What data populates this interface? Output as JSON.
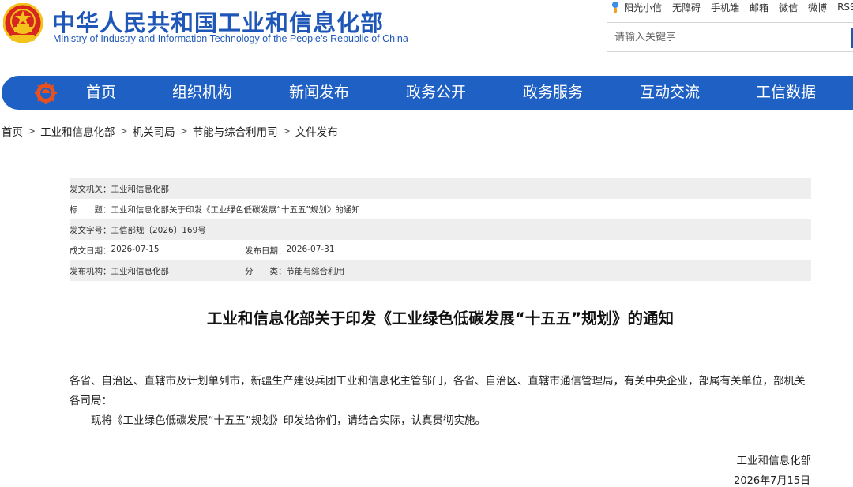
{
  "header": {
    "title": "中华人民共和国工业和信息化部",
    "subtitle": "Ministry of Industry and Information Technology of the People’s Republic of China",
    "top_links": [
      "阳光小信",
      "无障碍",
      "手机端",
      "邮箱",
      "微信",
      "微博",
      "RSS"
    ],
    "search_placeholder": "请输入关键字"
  },
  "nav": {
    "items": [
      "首页",
      "组织机构",
      "新闻发布",
      "政务公开",
      "政务服务",
      "互动交流",
      "工信数据"
    ]
  },
  "breadcrumb": [
    "首页",
    "工业和信息化部",
    "机关司局",
    "节能与综合利用司",
    "文件发布"
  ],
  "info": {
    "issuer_label": "发文机关：",
    "issuer": "工业和信息化部",
    "title_label": "标　　题：",
    "title": "工业和信息化部关于印发《工业绿色低碳发展“十五五”规划》的通知",
    "docno_label": "发文字号：",
    "docno": "工信部规〔2026〕169号",
    "written_label": "成文日期：",
    "written": "2026-07-15",
    "published_label": "发布日期：",
    "published": "2026-07-31",
    "agency_label": "发布机构：",
    "agency": "工业和信息化部",
    "category_label": "分　　类：",
    "category": "节能与综合利用"
  },
  "article": {
    "title": "工业和信息化部关于印发《工业绿色低碳发展“十五五”规划》的通知",
    "para1": "各省、自治区、直辖市及计划单列市，新疆生产建设兵团工业和信息化主管部门，各省、自治区、直辖市通信管理局，有关中央企业，部属有关单位，部机关各司局：",
    "para2": "现将《工业绿色低碳发展“十五五”规划》印发给你们，请结合实际，认真贯彻实施。",
    "sign_org": "工业和信息化部",
    "sign_date": "2026年7月15日"
  },
  "colors": {
    "brand_blue": "#1f60c4",
    "title_blue": "#1f57b8",
    "emblem_red": "#d7261e",
    "emblem_gold": "#f3c21b"
  }
}
